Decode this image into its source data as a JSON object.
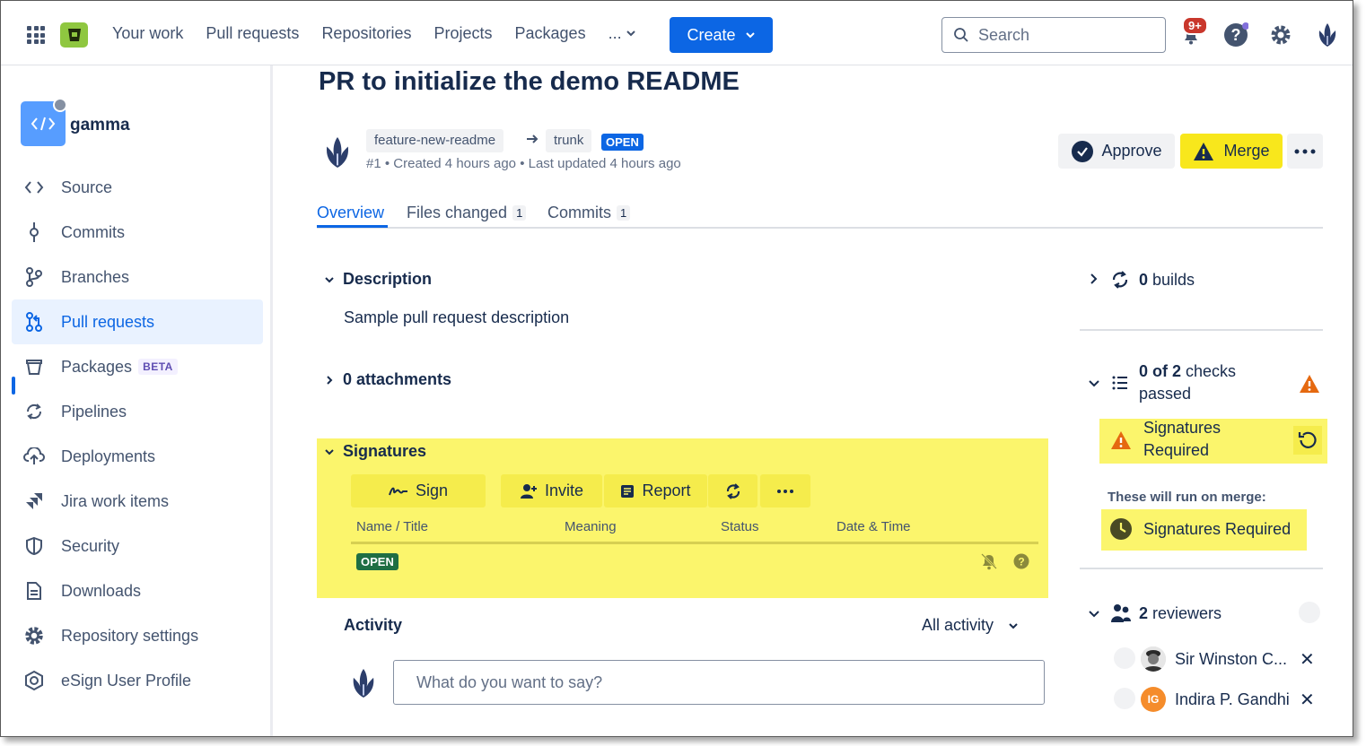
{
  "topnav": {
    "links": [
      "Your work",
      "Pull requests",
      "Repositories",
      "Projects",
      "Packages"
    ],
    "more_label": "...",
    "create_label": "Create",
    "search_placeholder": "Search",
    "notification_badge": "9+"
  },
  "sidebar": {
    "repo_name": "gamma",
    "items": [
      {
        "label": "Source",
        "icon": "code-icon"
      },
      {
        "label": "Commits",
        "icon": "commit-icon"
      },
      {
        "label": "Branches",
        "icon": "branch-icon"
      },
      {
        "label": "Pull requests",
        "icon": "pull-request-icon",
        "active": true
      },
      {
        "label": "Packages",
        "icon": "package-icon",
        "badge": "BETA"
      },
      {
        "label": "Pipelines",
        "icon": "pipelines-icon"
      },
      {
        "label": "Deployments",
        "icon": "deployments-icon"
      },
      {
        "label": "Jira work items",
        "icon": "jira-icon"
      },
      {
        "label": "Security",
        "icon": "shield-icon"
      },
      {
        "label": "Downloads",
        "icon": "file-icon"
      },
      {
        "label": "Repository settings",
        "icon": "gear-icon"
      },
      {
        "label": "eSign User Profile",
        "icon": "esign-icon"
      }
    ]
  },
  "pr": {
    "title": "PR to initialize the demo README",
    "source_branch": "feature-new-readme",
    "target_branch": "trunk",
    "status": "OPEN",
    "meta": "#1 • Created 4 hours ago • Last updated 4 hours ago",
    "approve_label": "Approve",
    "merge_label": "Merge"
  },
  "tabs": [
    {
      "label": "Overview",
      "count": ""
    },
    {
      "label": "Files changed",
      "count": "1"
    },
    {
      "label": "Commits",
      "count": "1"
    }
  ],
  "description": {
    "heading": "Description",
    "text": "Sample pull request description"
  },
  "attachments": {
    "heading": "0 attachments"
  },
  "signatures": {
    "heading": "Signatures",
    "buttons": {
      "sign": "Sign",
      "invite": "Invite",
      "report": "Report"
    },
    "columns": [
      "Name / Title",
      "Meaning",
      "Status",
      "Date & Time"
    ],
    "row_status": "OPEN"
  },
  "activity": {
    "heading": "Activity",
    "filter": "All activity",
    "comment_placeholder": "What do you want to say?"
  },
  "right_panel": {
    "builds_count": "0",
    "builds_label": "builds",
    "checks_count": "0 of 2",
    "checks_label_1": "checks",
    "checks_label_2": "passed",
    "sig_required_line1": "Signatures",
    "sig_required_line2": "Required",
    "on_merge_label": "These will run on merge:",
    "on_merge_item": "Signatures Required",
    "reviewers_count": "2",
    "reviewers_label": "reviewers",
    "reviewers": [
      {
        "name": "Sir Winston C...",
        "initials": ""
      },
      {
        "name": "Indira P. Gandhi",
        "initials": "IG"
      }
    ]
  },
  "colors": {
    "primary": "#0c66e4",
    "highlight_yellow": "#fbf56c",
    "merge_yellow": "#f8e71c",
    "warning_orange": "#e56910",
    "open_green": "#1f6e43"
  }
}
